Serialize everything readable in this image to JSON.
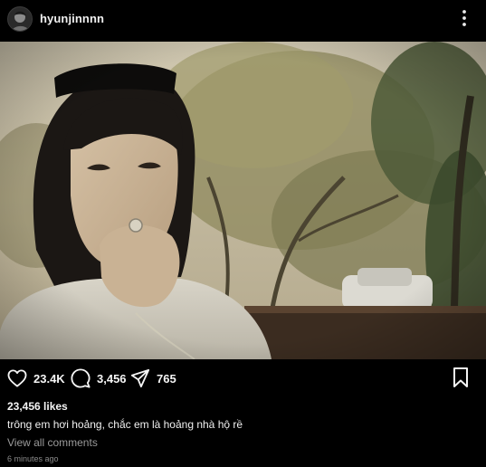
{
  "post": {
    "username": "hyunjinnnn",
    "likes_label": "23,456 likes",
    "caption": "trông em hơi hoảng, chắc em là hoảng nhà hộ rề",
    "view_all_comments": "View all comments",
    "timestamp": "6 minutes ago"
  },
  "actions": {
    "likes_count": "23.4K",
    "comments_count": "3,456",
    "shares_count": "765"
  },
  "icons": {
    "more": "more-options-icon",
    "like": "heart-icon",
    "comment": "comment-bubble-icon",
    "share": "send-icon",
    "save": "bookmark-icon"
  },
  "colors": {
    "background": "#000000",
    "text": "#f5f5f5",
    "muted": "#9a9a9a"
  }
}
